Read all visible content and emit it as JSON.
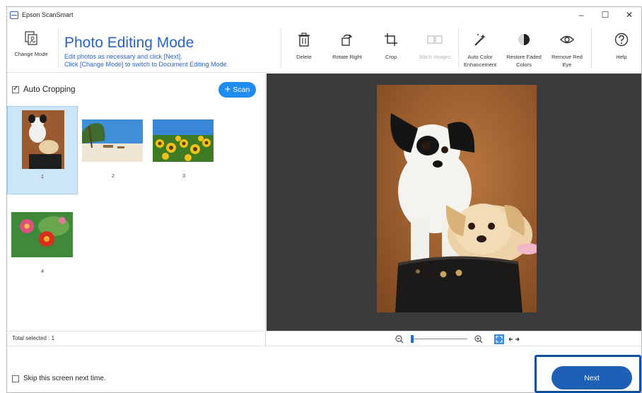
{
  "window": {
    "title": "Epson ScanSmart",
    "controls": [
      "–",
      "☐",
      "✕"
    ]
  },
  "ribbon": {
    "change_mode_label": "Change Mode",
    "mode_title": "Photo Editing Mode",
    "mode_desc_line1": "Edit photos as necessary and click [Next].",
    "mode_desc_line2": "Click [Change Mode] to switch to Document Editing Mode.",
    "tools": [
      {
        "label": "Delete",
        "icon": "trash-icon",
        "enabled": true
      },
      {
        "label": "Rotate Right",
        "icon": "rotate-right-icon",
        "enabled": true
      },
      {
        "label": "Crop",
        "icon": "crop-icon",
        "enabled": true
      },
      {
        "label": "Stitch Images",
        "icon": "stitch-icon",
        "enabled": false
      },
      {
        "label": "Auto Color\nEnhancement",
        "icon": "magic-wand-icon",
        "enabled": true
      },
      {
        "label": "Restore Faded\nColors",
        "icon": "restore-colors-icon",
        "enabled": true
      },
      {
        "label": "Remove Red\nEye",
        "icon": "eye-icon",
        "enabled": true
      },
      {
        "label": "Help",
        "icon": "help-icon",
        "enabled": true
      }
    ]
  },
  "left": {
    "auto_cropping_label": "Auto Cropping",
    "auto_cropping_checked": true,
    "scan_label": "Scan",
    "thumbnails": [
      {
        "num": "1",
        "subject": "dogs",
        "selected": true
      },
      {
        "num": "2",
        "subject": "beach",
        "selected": false
      },
      {
        "num": "3",
        "subject": "sunflowers",
        "selected": false
      },
      {
        "num": "4",
        "subject": "flowers",
        "selected": false
      }
    ],
    "total_selected": "Total selected : 1"
  },
  "zoom": {
    "level_fraction": 0.05
  },
  "bottom": {
    "skip_label": "Skip this screen next time.",
    "skip_checked": false,
    "next_label": "Next"
  },
  "colors": {
    "accent": "#1f8df0",
    "title_blue": "#2b63c4",
    "next_blue": "#1f5fb5",
    "preview_bg": "#3b3b3b"
  }
}
